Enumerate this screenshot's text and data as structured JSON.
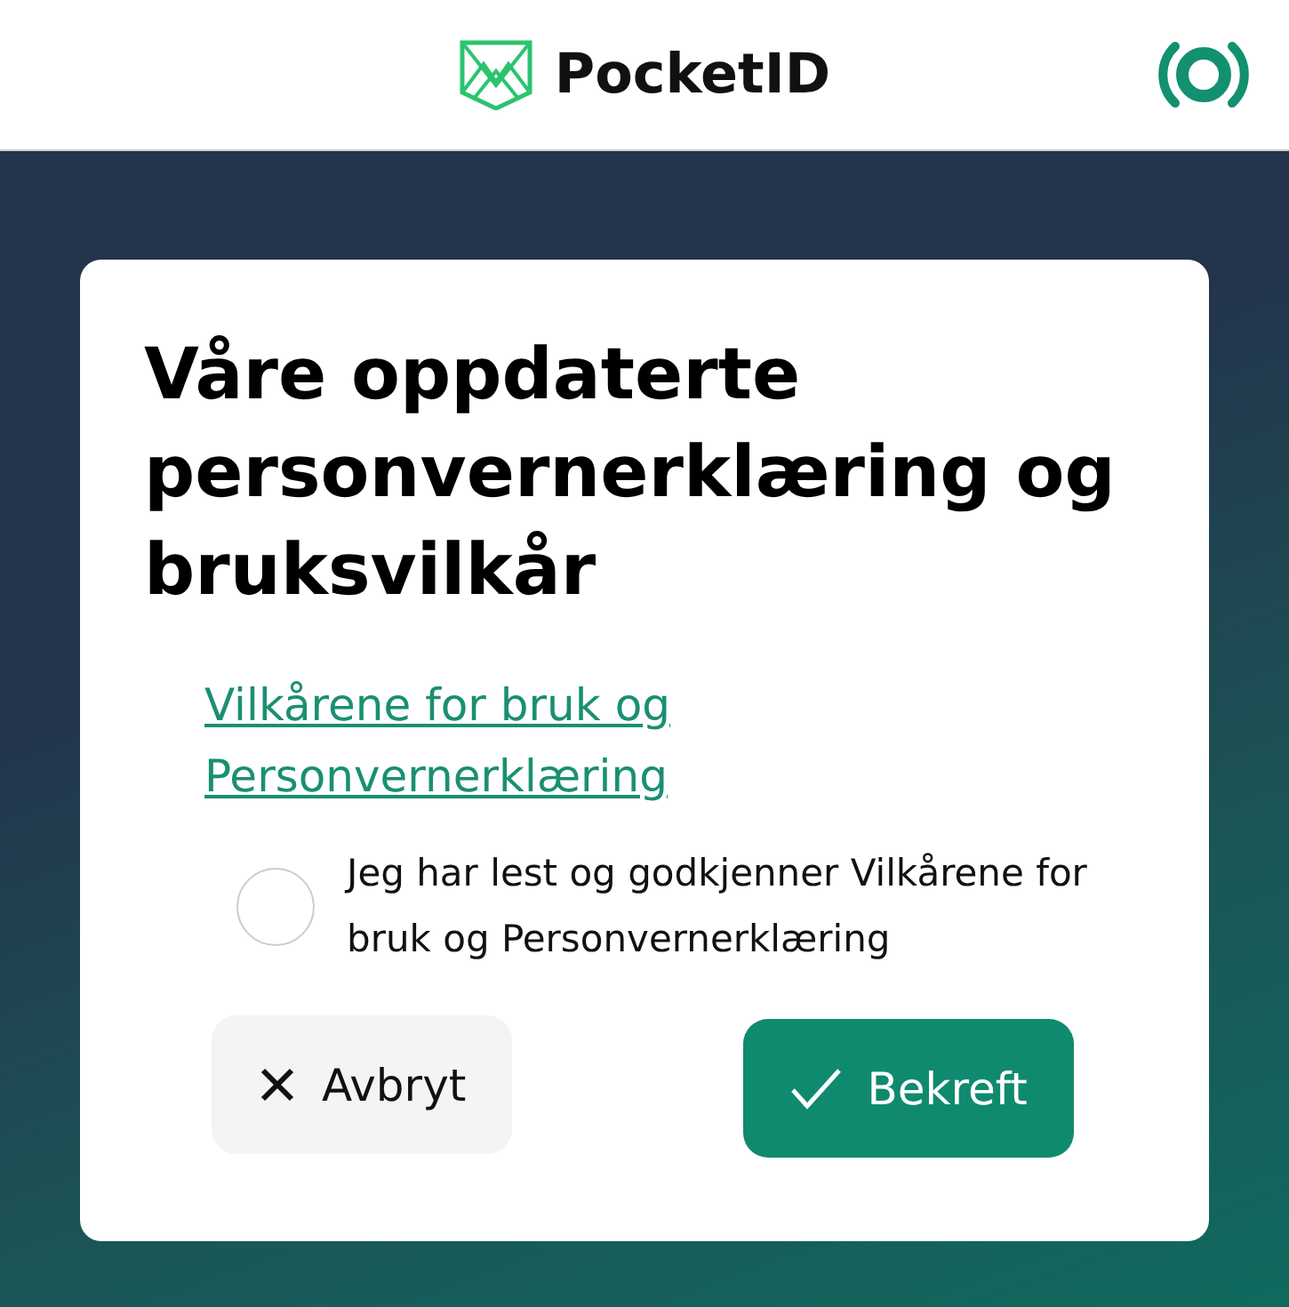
{
  "header": {
    "brand": "PocketID"
  },
  "dialog": {
    "title": "Våre oppdaterte personvernerklæring og bruksvilkår",
    "link": "Vilkårene for bruk og Personvernerklæring",
    "consent": {
      "label": "Jeg har lest og godkjenner Vilkårene for bruk og Personvernerklæring",
      "checked": false
    },
    "buttons": [
      {
        "kind": "cancel",
        "label": "Avbryt"
      },
      {
        "kind": "confirm",
        "label": "Bekreft"
      }
    ]
  }
}
